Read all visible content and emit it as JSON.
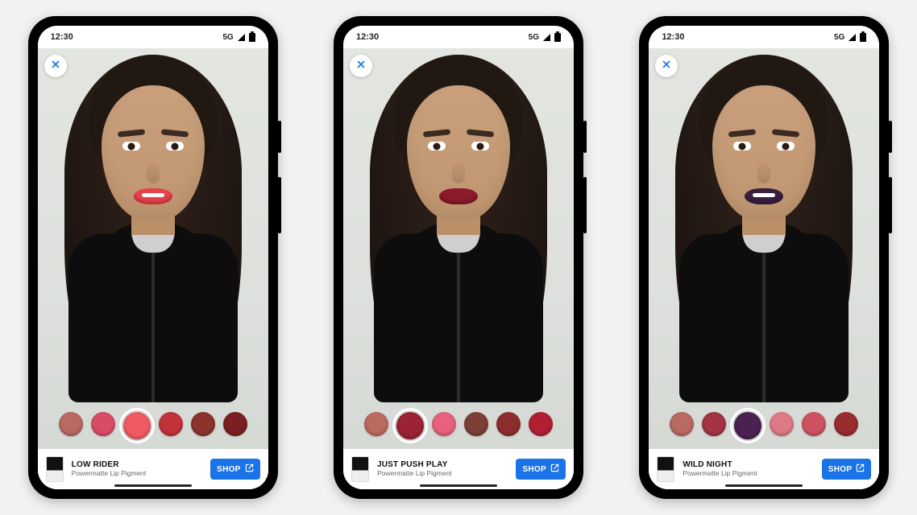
{
  "status": {
    "time": "12:30",
    "network": "5G"
  },
  "shop_label": "SHOP",
  "product_subtitle": "Powermatte Lip Pigment",
  "phones": [
    {
      "product_name": "LOW RIDER",
      "lip_color": "#e8414a",
      "teeth_visible": true,
      "selected_index": 2,
      "swatches": [
        "#b96a61",
        "#d94b66",
        "#f05a63",
        "#c13338",
        "#8a342c",
        "#7a2020"
      ]
    },
    {
      "product_name": "JUST PUSH PLAY",
      "lip_color": "#8e1a2e",
      "teeth_visible": false,
      "selected_index": 1,
      "swatches": [
        "#bb6a60",
        "#9c2236",
        "#e8627e",
        "#7c4038",
        "#8d2e2e",
        "#b21f35"
      ]
    },
    {
      "product_name": "WILD NIGHT",
      "lip_color": "#3a1e40",
      "teeth_visible": true,
      "selected_index": 2,
      "swatches": [
        "#b96a61",
        "#a33345",
        "#4a2150",
        "#dd7a87",
        "#ce5362",
        "#9a2b30"
      ]
    }
  ]
}
